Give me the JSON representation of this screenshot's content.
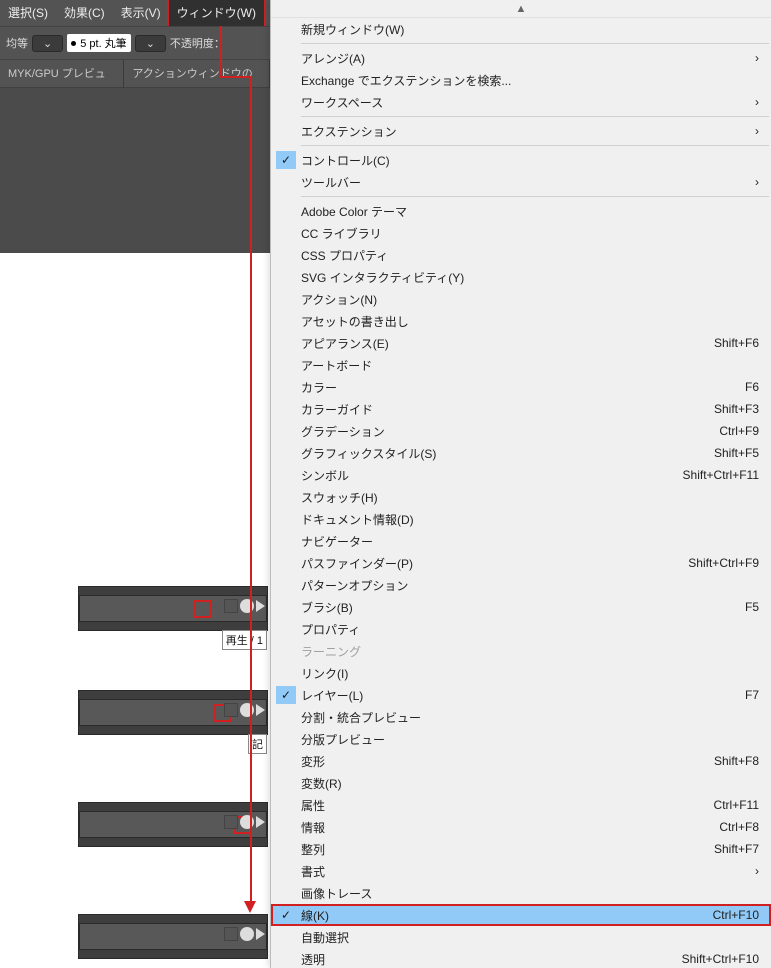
{
  "menubar": {
    "items": [
      "選択(S)",
      "効果(C)",
      "表示(V)",
      "ウィンドウ(W)"
    ]
  },
  "toolbar": {
    "uniform": "均等",
    "stroke_weight": "5 pt. 丸筆",
    "opacity_label": "不透明度："
  },
  "tabbar": {
    "tab1": "MYK/GPU プレビュー)",
    "tab2": "アクションウィンドウのボタン"
  },
  "strips": {
    "label1": "再生 / 1",
    "label2": "記"
  },
  "menu": {
    "new_window": "新規ウィンドウ(W)",
    "arrange": "アレンジ(A)",
    "exchange_search": "Exchange でエクステンションを検索...",
    "workspace": "ワークスペース",
    "extension": "エクステンション",
    "control": "コントロール(C)",
    "toolbar_m": "ツールバー",
    "adobe_color": "Adobe Color テーマ",
    "cc_library": "CC ライブラリ",
    "css_props": "CSS プロパティ",
    "svg_inter": "SVG インタラクティビティ(Y)",
    "action": "アクション(N)",
    "asset_export": "アセットの書き出し",
    "appearance": "アピアランス(E)",
    "appearance_sc": "Shift+F6",
    "artboard": "アートボード",
    "color": "カラー",
    "color_sc": "F6",
    "color_guide": "カラーガイド",
    "color_guide_sc": "Shift+F3",
    "gradation": "グラデーション",
    "gradation_sc": "Ctrl+F9",
    "graphic_style": "グラフィックスタイル(S)",
    "graphic_style_sc": "Shift+F5",
    "symbol": "シンボル",
    "symbol_sc": "Shift+Ctrl+F11",
    "swatch": "スウォッチ(H)",
    "doc_info": "ドキュメント情報(D)",
    "navigator": "ナビゲーター",
    "pathfinder": "パスファインダー(P)",
    "pathfinder_sc": "Shift+Ctrl+F9",
    "pattern_opt": "パターンオプション",
    "brush": "ブラシ(B)",
    "brush_sc": "F5",
    "property": "プロパティ",
    "learning": "ラーニング",
    "link": "リンク(I)",
    "layer": "レイヤー(L)",
    "layer_sc": "F7",
    "split_merge": "分割・統合プレビュー",
    "separation": "分版プレビュー",
    "transform": "変形",
    "transform_sc": "Shift+F8",
    "variables": "変数(R)",
    "attr": "属性",
    "attr_sc": "Ctrl+F11",
    "info": "情報",
    "info_sc": "Ctrl+F8",
    "align": "整列",
    "align_sc": "Shift+F7",
    "type": "書式",
    "image_trace": "画像トレース",
    "stroke": "線(K)",
    "stroke_sc": "Ctrl+F10",
    "auto_select": "自動選択",
    "transparency": "透明",
    "transparency_sc": "Shift+Ctrl+F10"
  }
}
